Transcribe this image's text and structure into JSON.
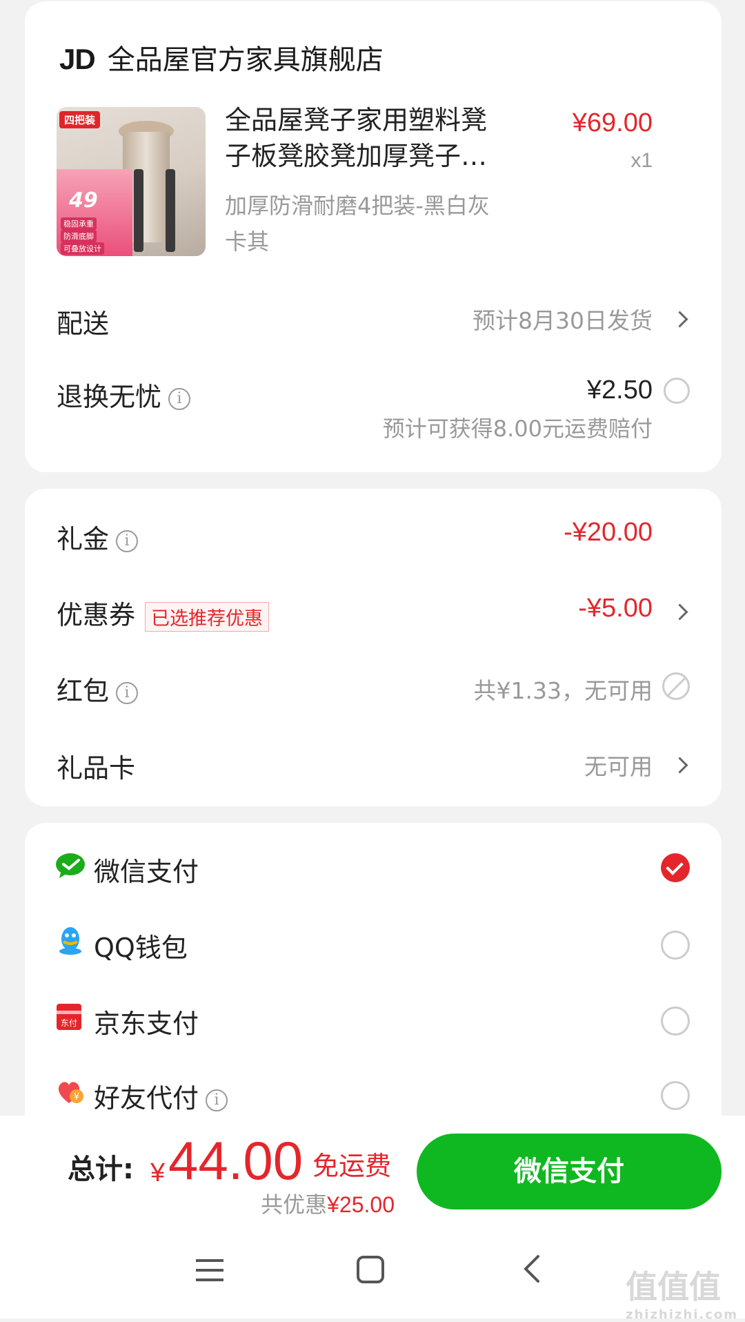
{
  "shop": {
    "logo": "JD",
    "name": "全品屋官方家具旗舰店"
  },
  "product": {
    "image_badge": "四把装",
    "image_price": "49",
    "image_tags": [
      "稳固承重",
      "防滑底脚",
      "可叠放设计"
    ],
    "name_line1": "全品屋凳子家用塑料凳",
    "name_line2": "子板凳胶凳加厚凳子…",
    "price": "¥69.00",
    "qty": "x1",
    "spec_line1": "加厚防滑耐磨4把装-黑白灰",
    "spec_line2": "卡其"
  },
  "delivery": {
    "label": "配送",
    "value": "预计8月30日发货"
  },
  "returns": {
    "label": "退换无忧",
    "price": "¥2.50",
    "note": "预计可获得8.00元运费赔付"
  },
  "discounts": {
    "gift_money": {
      "label": "礼金",
      "value": "-¥20.00"
    },
    "coupon": {
      "label": "优惠券",
      "tag": "已选推荐优惠",
      "value": "-¥5.00"
    },
    "red_packet": {
      "label": "红包",
      "value": "共¥1.33，无可用"
    },
    "gift_card": {
      "label": "礼品卡",
      "value": "无可用"
    }
  },
  "payments": [
    {
      "label": "微信支付",
      "icon": "wechat-icon",
      "selected": true
    },
    {
      "label": "QQ钱包",
      "icon": "qq-icon",
      "selected": false
    },
    {
      "label": "京东支付",
      "icon": "jd-pay-icon",
      "selected": false
    },
    {
      "label": "好友代付",
      "icon": "friend-pay-icon",
      "selected": false
    }
  ],
  "footer": {
    "total_label": "总计:",
    "currency": "¥",
    "total": "44.00",
    "shipping": "免运费",
    "saved_prefix": "共优惠",
    "saved_value": "¥25.00",
    "pay_button": "微信支付"
  },
  "watermark": {
    "text": "值值值",
    "sub": "zhizhizhi.com"
  },
  "colors": {
    "accent_red": "#e4262c",
    "wechat_green": "#0fb820",
    "background": "#f2f2f2"
  }
}
